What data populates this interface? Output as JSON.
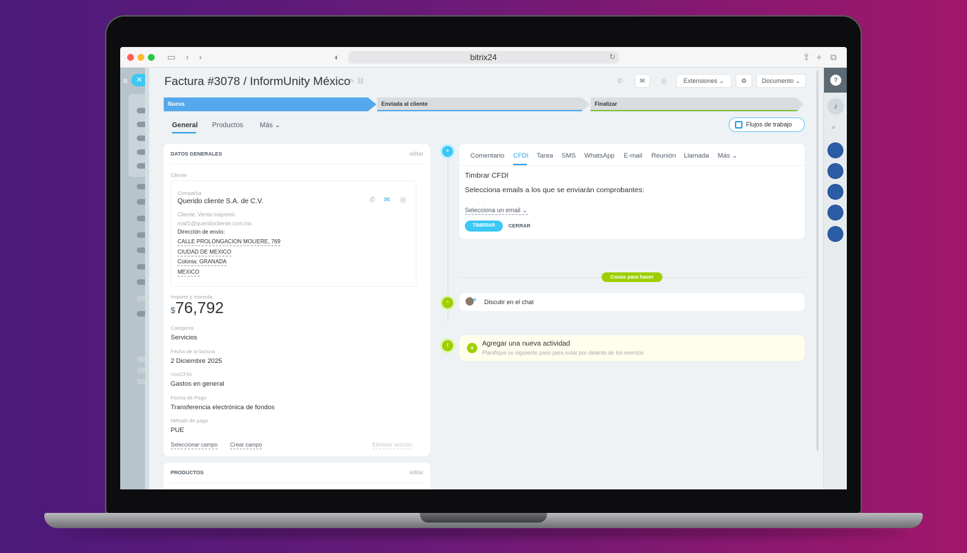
{
  "browser": {
    "url": "bitrix24",
    "sidebar_icon": "sidebar-icon",
    "back_icon": "chevron-left-icon",
    "forward_icon": "chevron-right-icon",
    "shield_icon": "shield-icon",
    "reload_icon": "reload-icon",
    "share_icon": "share-icon",
    "new_tab_icon": "plus-icon",
    "tabs_icon": "tabs-icon"
  },
  "header": {
    "title": "Factura #3078 / InformUnity México",
    "extensions_label": "Extensiones",
    "document_label": "Documento"
  },
  "stages": [
    {
      "label": "Nueva",
      "color": "#54a8eb"
    },
    {
      "label": "Enviada al cliente",
      "color": "#54a8eb"
    },
    {
      "label": "Finalizar",
      "color": "#7fc242"
    }
  ],
  "tabs": {
    "general": "General",
    "products": "Productos",
    "more": "Más"
  },
  "workflow_button": "Flujos de trabajo",
  "general_card": {
    "title": "DATOS GENERALES",
    "edit": "editar",
    "client_label": "Cliente",
    "company_label": "Compañía",
    "company_name": "Querido cliente S.A. de C.V.",
    "client_type": "Cliente, Venta mayoreo",
    "email": "mail1@queridocliente.com.mx",
    "shipping_label": "Dirección de envío:",
    "address": [
      "CALLE PROLONGACION MOLIERE, 769",
      "CIUDAD DE MEXICO",
      "Colonia: GRANADA",
      "MEXICO"
    ],
    "amount_label": "Importe y moneda",
    "currency_symbol": "$",
    "amount": "76,792",
    "fields": [
      {
        "label": "Categoría",
        "value": "Servicios"
      },
      {
        "label": "Fecha de la factura",
        "value": "2 Diciembre 2025"
      },
      {
        "label": "UsoCFDI",
        "value": "Gastos en general"
      },
      {
        "label": "Forma de Pago",
        "value": "Transferencia electrónica de fondos"
      },
      {
        "label": "Método de pago",
        "value": "PUE"
      }
    ],
    "select_field": "Seleccionar campo",
    "create_field": "Crear campo",
    "delete_section": "Eliminar sección"
  },
  "products_card": {
    "title": "PRODUCTOS",
    "edit": "editar"
  },
  "activity": {
    "tabs": [
      "Comentario",
      "CFDI",
      "Tarea",
      "SMS",
      "WhatsApp",
      "E-mail",
      "Reunión",
      "Llamada",
      "Más"
    ],
    "active_tab": "CFDI",
    "heading": "Timbrar CFDI",
    "instruction": "Selecciona emails a los que se enviarán comprobantes:",
    "email_select": "Selecciona un email",
    "primary_button": "TIMBRAR",
    "secondary_button": "CERRAR"
  },
  "chat": {
    "label": "Discutir en el chat"
  },
  "todo": {
    "badge": "Cosas para hacer",
    "title": "Agregar una nueva actividad",
    "subtitle": "Planifique su siguiente paso para estar por delante de los eventos"
  },
  "colors": {
    "accent": "#2fa2e3",
    "primary_button": "#3bc8f5",
    "todo_green": "#9dcf00",
    "todo_bg": "#fffdec"
  }
}
